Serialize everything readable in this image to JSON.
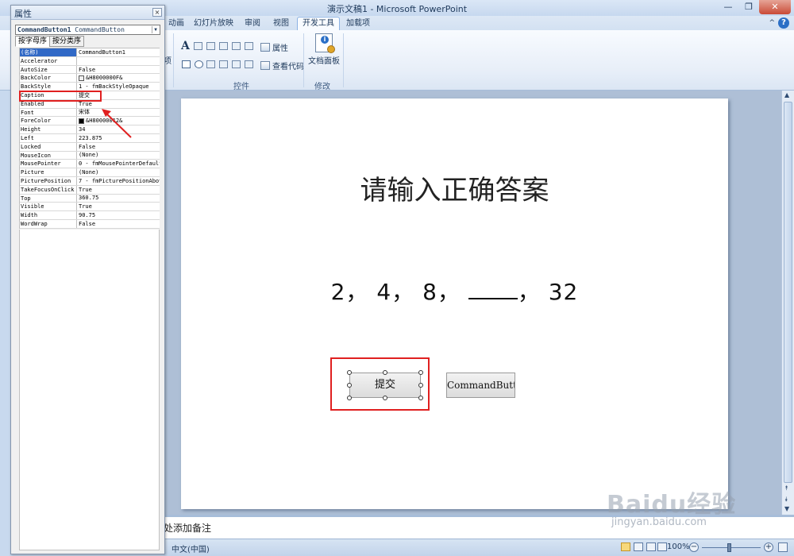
{
  "window": {
    "title": "演示文稿1 - Microsoft PowerPoint",
    "minimize": "—",
    "maximize": "❐",
    "close": "✕"
  },
  "ribbon": {
    "tabs": [
      "动画",
      "幻灯片放映",
      "审阅",
      "视图",
      "开发工具",
      "加载项"
    ],
    "active_tab": "开发工具",
    "partial_label": "项",
    "controls_group_label": "控件",
    "modify_group_label": "修改",
    "properties_label": "属性",
    "view_code_label": "查看代码",
    "doc_panel_label": "文档面板",
    "help": "?",
    "caret": "^"
  },
  "properties_window": {
    "title": "属性",
    "close": "×",
    "object_name": "CommandButton1",
    "object_type": "CommandButton",
    "tabs": [
      "按字母序",
      "按分类序"
    ],
    "rows": [
      {
        "name": "(名称)",
        "value": "CommandButton1"
      },
      {
        "name": "Accelerator",
        "value": ""
      },
      {
        "name": "AutoSize",
        "value": "False"
      },
      {
        "name": "BackColor",
        "value": "&H8000000F&"
      },
      {
        "name": "BackStyle",
        "value": "1 - fmBackStyleOpaque"
      },
      {
        "name": "Caption",
        "value": "提交"
      },
      {
        "name": "Enabled",
        "value": "True"
      },
      {
        "name": "Font",
        "value": "宋体"
      },
      {
        "name": "ForeColor",
        "value": "&H80000012&"
      },
      {
        "name": "Height",
        "value": "34"
      },
      {
        "name": "Left",
        "value": "223.875"
      },
      {
        "name": "Locked",
        "value": "False"
      },
      {
        "name": "MouseIcon",
        "value": "(None)"
      },
      {
        "name": "MousePointer",
        "value": "0 - fmMousePointerDefault"
      },
      {
        "name": "Picture",
        "value": "(None)"
      },
      {
        "name": "PicturePosition",
        "value": "7 - fmPicturePositionAboveCenter"
      },
      {
        "name": "TakeFocusOnClick",
        "value": "True"
      },
      {
        "name": "Top",
        "value": "360.75"
      },
      {
        "name": "Visible",
        "value": "True"
      },
      {
        "name": "Width",
        "value": "90.75"
      },
      {
        "name": "WordWrap",
        "value": "False"
      }
    ]
  },
  "slide": {
    "title": "请输入正确答案",
    "seq_a": "2，",
    "seq_b": "4，",
    "seq_c": "8，",
    "seq_d": "，",
    "seq_e": "32",
    "submit_button": "提交",
    "second_button": "CommandButt"
  },
  "notes": {
    "text": "处添加备注"
  },
  "statusbar": {
    "language": "中文(中国)",
    "zoom": "100%",
    "zoom_minus": "−",
    "zoom_plus": "+"
  },
  "watermark": {
    "main": "Baidu经验",
    "sub": "jingyan.baidu.com"
  },
  "colors": {
    "annotation_red": "#e02020",
    "selection_blue": "#3169c6"
  }
}
